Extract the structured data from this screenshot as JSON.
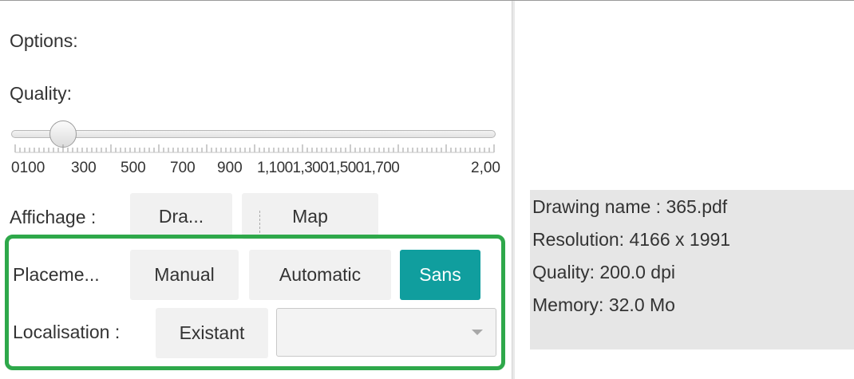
{
  "options": {
    "title": "Options:",
    "quality_label": "Quality:",
    "quality_slider": {
      "min": 100,
      "max": 2000,
      "value": 200,
      "tick_labels": [
        "0100",
        "300",
        "500",
        "700",
        "900",
        "1,1001,3001,5001,700",
        "2,00"
      ]
    },
    "affichage": {
      "label": "Affichage :",
      "buttons": [
        "Dra...",
        "Map"
      ]
    },
    "placement": {
      "label": "Placeme...",
      "buttons": [
        "Manual",
        "Automatic",
        "Sans"
      ],
      "selected": "Sans"
    },
    "localisation": {
      "label": "Localisation :",
      "button": "Existant",
      "combo_value": ""
    }
  },
  "info": {
    "drawing_name": "Drawing name : 365.pdf",
    "resolution": "Resolution:  4166 x 1991",
    "quality": "Quality: 200.0 dpi",
    "memory": "Memory: 32.0 Mo"
  },
  "colors": {
    "selected_button": "#109e9e",
    "highlight_border": "#2ea84a",
    "info_panel_bg": "#e6e6e6"
  },
  "icons": {
    "combo_arrow": "chevron-down-icon"
  }
}
